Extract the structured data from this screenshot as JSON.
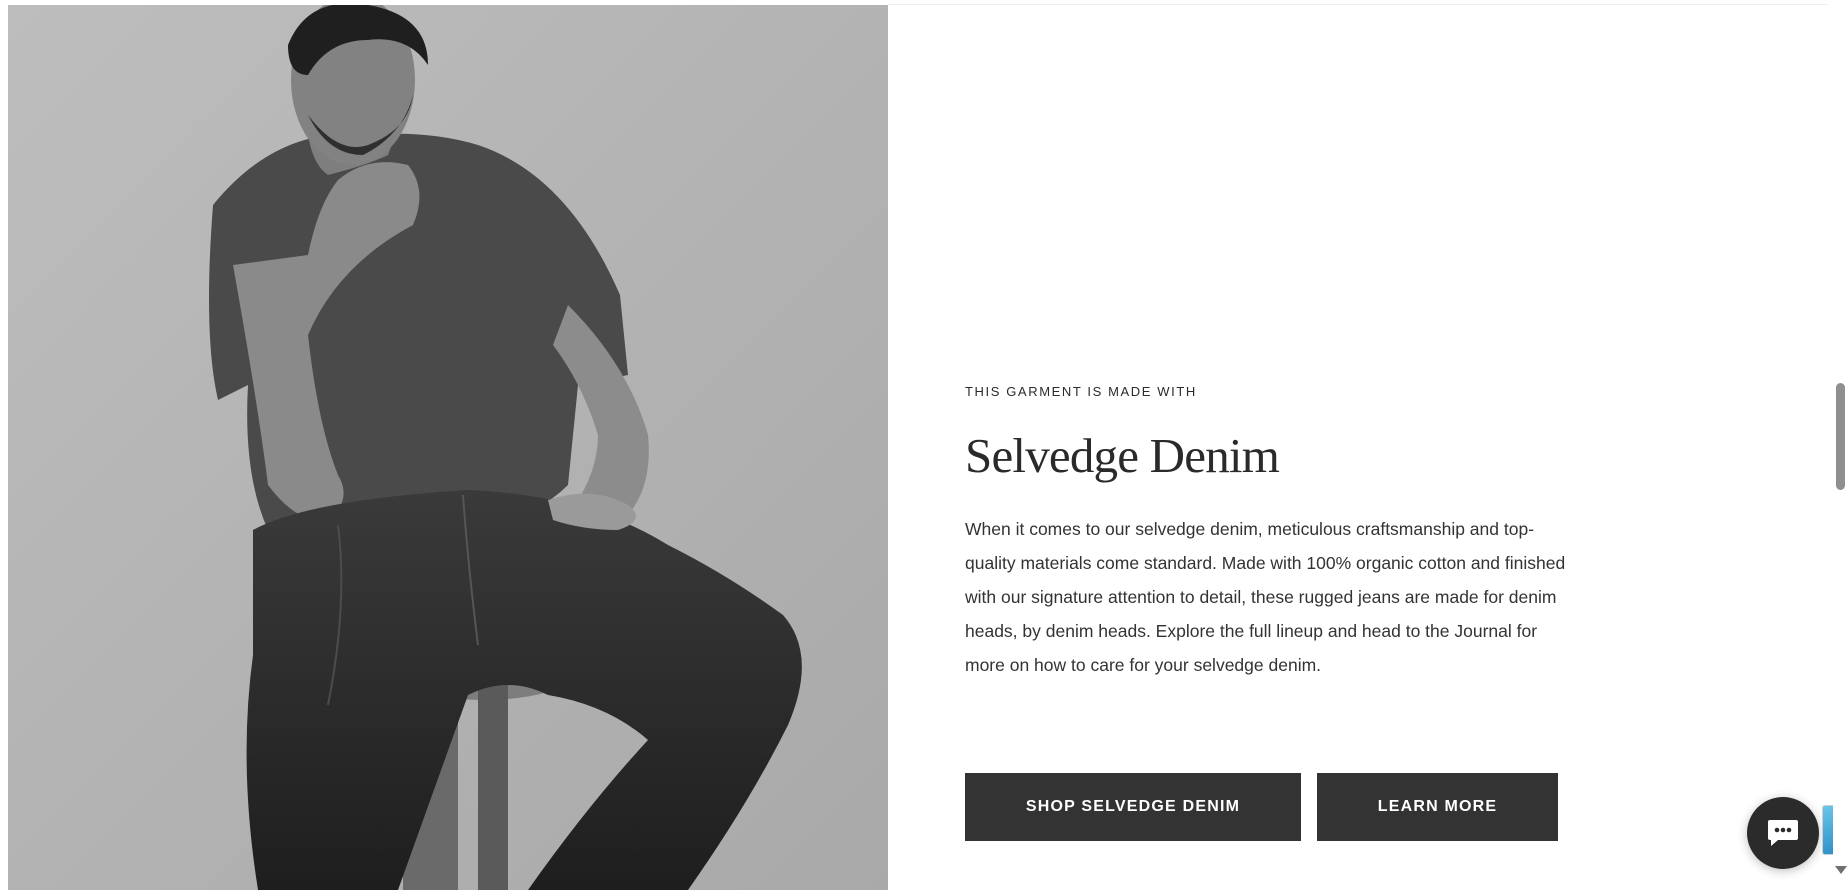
{
  "hero": {
    "image_alt": "Man in t-shirt and selvedge jeans sitting on a wooden stool"
  },
  "section": {
    "eyebrow": "THIS GARMENT IS MADE WITH",
    "title": "Selvedge Denim",
    "description": "When it comes to our selvedge denim, meticulous craftsmanship and top-quality materials come standard. Made with 100% organic cotton and finished with our signature attention to detail, these rugged jeans are made for denim heads, by denim heads. Explore the full lineup and head to the Journal for more on how to care for your selvedge denim."
  },
  "buttons": {
    "shop_label": "SHOP SELVEDGE DENIM",
    "learn_label": "LEARN MORE"
  },
  "widgets": {
    "chat_icon": "chat-bubble-icon"
  },
  "colors": {
    "button_bg": "#333333",
    "button_text": "#ffffff",
    "text": "#2a2a2a",
    "chat_bg": "#2b2b2b"
  }
}
